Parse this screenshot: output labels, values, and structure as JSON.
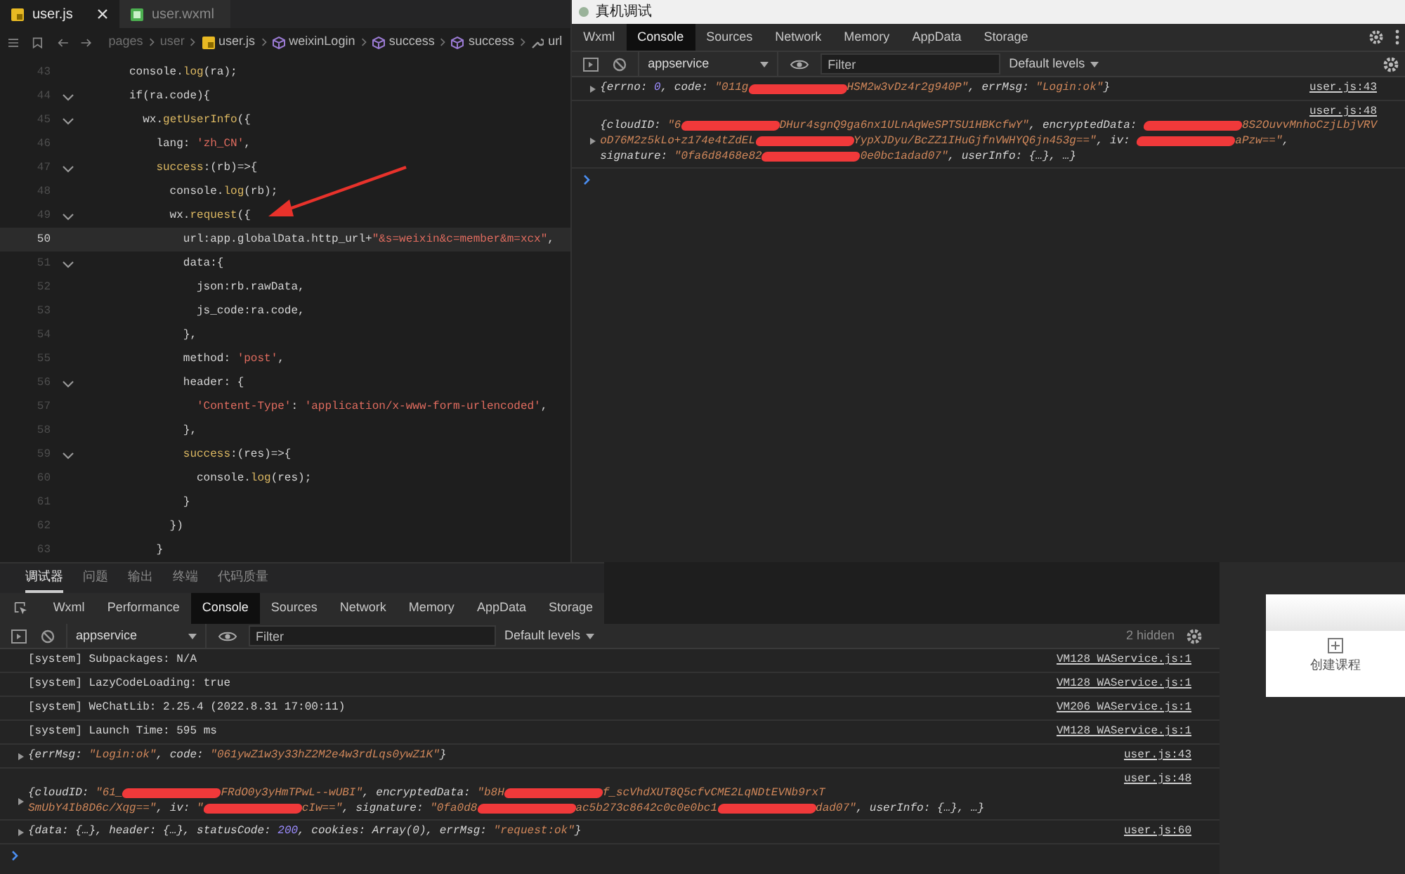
{
  "editor": {
    "tabs": [
      {
        "label": "user.js",
        "kind": "js",
        "selected": true
      },
      {
        "label": "user.wxml",
        "kind": "wxml",
        "selected": false
      }
    ],
    "breadcrumb": [
      {
        "kind": "folder",
        "label": "pages"
      },
      {
        "kind": "folder",
        "label": "user"
      },
      {
        "kind": "file",
        "label": "user.js"
      },
      {
        "kind": "method",
        "label": "weixinLogin"
      },
      {
        "kind": "method",
        "label": "success"
      },
      {
        "kind": "method",
        "label": "success"
      },
      {
        "kind": "property",
        "label": "url"
      }
    ],
    "lines": [
      {
        "number": "43",
        "foldable": false,
        "current": false,
        "tokens": [
          {
            "kind": "plain",
            "text": "console."
          },
          {
            "kind": "fn",
            "text": "log"
          },
          {
            "kind": "plain",
            "text": "(ra);"
          }
        ]
      },
      {
        "number": "44",
        "foldable": true,
        "current": false,
        "tokens": [
          {
            "kind": "plain",
            "text": "if(ra.code){"
          }
        ]
      },
      {
        "number": "45",
        "foldable": true,
        "current": false,
        "tokens": [
          {
            "kind": "plain",
            "text": "  wx."
          },
          {
            "kind": "fn",
            "text": "getUserInfo"
          },
          {
            "kind": "plain",
            "text": "({"
          }
        ]
      },
      {
        "number": "46",
        "foldable": false,
        "current": false,
        "tokens": [
          {
            "kind": "plain",
            "text": "    lang: "
          },
          {
            "kind": "str",
            "text": "'zh_CN'"
          },
          {
            "kind": "plain",
            "text": ","
          }
        ]
      },
      {
        "number": "47",
        "foldable": true,
        "current": false,
        "tokens": [
          {
            "kind": "fn",
            "text": "    success"
          },
          {
            "kind": "plain",
            "text": ":(rb)=>{"
          }
        ]
      },
      {
        "number": "48",
        "foldable": false,
        "current": false,
        "tokens": [
          {
            "kind": "plain",
            "text": "      console."
          },
          {
            "kind": "fn",
            "text": "log"
          },
          {
            "kind": "plain",
            "text": "(rb);"
          }
        ]
      },
      {
        "number": "49",
        "foldable": true,
        "current": false,
        "tokens": [
          {
            "kind": "plain",
            "text": "      wx."
          },
          {
            "kind": "fn",
            "text": "request"
          },
          {
            "kind": "plain",
            "text": "({"
          }
        ]
      },
      {
        "number": "50",
        "foldable": false,
        "current": true,
        "tokens": [
          {
            "kind": "plain",
            "text": "        url:app.globalData.http_url+"
          },
          {
            "kind": "str",
            "text": "\"&s=weixin&c=member&m=xcx\""
          },
          {
            "kind": "plain",
            "text": ","
          }
        ]
      },
      {
        "number": "51",
        "foldable": true,
        "current": false,
        "tokens": [
          {
            "kind": "plain",
            "text": "        data:{"
          }
        ]
      },
      {
        "number": "52",
        "foldable": false,
        "current": false,
        "tokens": [
          {
            "kind": "plain",
            "text": "          json:rb.rawData,"
          }
        ]
      },
      {
        "number": "53",
        "foldable": false,
        "current": false,
        "tokens": [
          {
            "kind": "plain",
            "text": "          js_code:ra.code,"
          }
        ]
      },
      {
        "number": "54",
        "foldable": false,
        "current": false,
        "tokens": [
          {
            "kind": "plain",
            "text": "        },"
          }
        ]
      },
      {
        "number": "55",
        "foldable": false,
        "current": false,
        "tokens": [
          {
            "kind": "plain",
            "text": "        method: "
          },
          {
            "kind": "str",
            "text": "'post'"
          },
          {
            "kind": "plain",
            "text": ","
          }
        ]
      },
      {
        "number": "56",
        "foldable": true,
        "current": false,
        "tokens": [
          {
            "kind": "plain",
            "text": "        header: {"
          }
        ]
      },
      {
        "number": "57",
        "foldable": false,
        "current": false,
        "tokens": [
          {
            "kind": "str",
            "text": "          'Content-Type'"
          },
          {
            "kind": "plain",
            "text": ": "
          },
          {
            "kind": "str",
            "text": "'application/x-www-form-urlencoded'"
          },
          {
            "kind": "plain",
            "text": ","
          }
        ]
      },
      {
        "number": "58",
        "foldable": false,
        "current": false,
        "tokens": [
          {
            "kind": "plain",
            "text": "        },"
          }
        ]
      },
      {
        "number": "59",
        "foldable": true,
        "current": false,
        "tokens": [
          {
            "kind": "fn",
            "text": "        success"
          },
          {
            "kind": "plain",
            "text": ":(res)=>{"
          }
        ]
      },
      {
        "number": "60",
        "foldable": false,
        "current": false,
        "tokens": [
          {
            "kind": "plain",
            "text": "          console."
          },
          {
            "kind": "fn",
            "text": "log"
          },
          {
            "kind": "plain",
            "text": "(res);"
          }
        ]
      },
      {
        "number": "61",
        "foldable": false,
        "current": false,
        "tokens": [
          {
            "kind": "plain",
            "text": "        }"
          }
        ]
      },
      {
        "number": "62",
        "foldable": false,
        "current": false,
        "tokens": [
          {
            "kind": "plain",
            "text": "      })"
          }
        ]
      },
      {
        "number": "63",
        "foldable": false,
        "current": false,
        "tokens": [
          {
            "kind": "plain",
            "text": "    }"
          }
        ]
      }
    ]
  },
  "device_debugger": {
    "title": "真机调试",
    "tabs": [
      {
        "label": "Wxml",
        "selected": false
      },
      {
        "label": "Console",
        "selected": true
      },
      {
        "label": "Sources",
        "selected": false
      },
      {
        "label": "Network",
        "selected": false
      },
      {
        "label": "Memory",
        "selected": false
      },
      {
        "label": "AppData",
        "selected": false
      },
      {
        "label": "Storage",
        "selected": false
      }
    ],
    "context": "appservice",
    "filter_placeholder": "Filter",
    "levels": "Default levels",
    "entries": [
      {
        "source": "user.js:43",
        "expandable": true,
        "lines": [
          [
            {
              "kind": "text",
              "text": "{errno: "
            },
            {
              "kind": "num",
              "text": "0"
            },
            {
              "kind": "text",
              "text": ", code: "
            },
            {
              "kind": "str",
              "text": "\"011g"
            },
            {
              "kind": "redaction"
            },
            {
              "kind": "str",
              "text": "HSM2w3vDz4r2g940P\""
            },
            {
              "kind": "text",
              "text": ", errMsg: "
            },
            {
              "kind": "str",
              "text": "\"Login:ok\""
            },
            {
              "kind": "text",
              "text": "}"
            }
          ]
        ]
      },
      {
        "source": "user.js:48",
        "expandable": true,
        "lines": [
          [
            {
              "kind": "text",
              "text": "{cloudID: "
            },
            {
              "kind": "str",
              "text": "\"6"
            },
            {
              "kind": "redaction"
            },
            {
              "kind": "str",
              "text": "DHur4sgnQ9ga6nx1ULnAqWeSPTSU1HBKcfwY\""
            },
            {
              "kind": "text",
              "text": ", encryptedData: "
            },
            {
              "kind": "redaction"
            },
            {
              "kind": "str",
              "text": "8S2OuvvMnhoCzjLbjVRV"
            }
          ],
          [
            {
              "kind": "str",
              "text": "oD76M2z5kLo+z174e4tZdEL"
            },
            {
              "kind": "redaction"
            },
            {
              "kind": "str",
              "text": "YypXJDyu/BcZZ1IHuGjfnVWHYQ6jn453g==\""
            },
            {
              "kind": "text",
              "text": ", iv: "
            },
            {
              "kind": "redaction"
            },
            {
              "kind": "str",
              "text": "aPzw==\""
            },
            {
              "kind": "text",
              "text": ","
            }
          ],
          [
            {
              "kind": "text",
              "text": "signature: "
            },
            {
              "kind": "str",
              "text": "\"0fa6d8468e82"
            },
            {
              "kind": "redaction"
            },
            {
              "kind": "str",
              "text": "0e0bc1adad07\""
            },
            {
              "kind": "text",
              "text": ", userInfo: {…}, …}"
            }
          ]
        ]
      }
    ]
  },
  "bottom_panel": {
    "tabs": [
      {
        "label": "调试器",
        "selected": true
      },
      {
        "label": "问题",
        "selected": false
      },
      {
        "label": "输出",
        "selected": false
      },
      {
        "label": "终端",
        "selected": false
      },
      {
        "label": "代码质量",
        "selected": false
      }
    ],
    "devtools_tabs": [
      {
        "label": "Wxml",
        "selected": false
      },
      {
        "label": "Performance",
        "selected": false
      },
      {
        "label": "Console",
        "selected": true
      },
      {
        "label": "Sources",
        "selected": false
      },
      {
        "label": "Network",
        "selected": false
      },
      {
        "label": "Memory",
        "selected": false
      },
      {
        "label": "AppData",
        "selected": false
      },
      {
        "label": "Storage",
        "selected": false
      }
    ],
    "context": "appservice",
    "filter_placeholder": "Filter",
    "levels": "Default levels",
    "hidden": "2 hidden",
    "entries": [
      {
        "source": "VM128 WAService.js:1",
        "expandable": false,
        "lines": [
          [
            {
              "kind": "text",
              "text": "[system] Subpackages: N/A"
            }
          ]
        ]
      },
      {
        "source": "VM128 WAService.js:1",
        "expandable": false,
        "lines": [
          [
            {
              "kind": "text",
              "text": "[system] LazyCodeLoading: true"
            }
          ]
        ]
      },
      {
        "source": "VM206 WAService.js:1",
        "expandable": false,
        "lines": [
          [
            {
              "kind": "text",
              "text": "[system] WeChatLib: 2.25.4 (2022.8.31 17:00:11)"
            }
          ]
        ]
      },
      {
        "source": "VM128 WAService.js:1",
        "expandable": false,
        "lines": [
          [
            {
              "kind": "text",
              "text": "[system] Launch Time: 595 ms"
            }
          ]
        ]
      },
      {
        "source": "user.js:43",
        "expandable": true,
        "lines": [
          [
            {
              "kind": "text",
              "text": "{errMsg: "
            },
            {
              "kind": "str",
              "text": "\"Login:ok\""
            },
            {
              "kind": "text",
              "text": ", code: "
            },
            {
              "kind": "str",
              "text": "\"061ywZ1w3y33hZ2M2e4w3rdLqs0ywZ1K\""
            },
            {
              "kind": "text",
              "text": "}"
            }
          ]
        ]
      },
      {
        "source": "user.js:48",
        "expandable": true,
        "lines": [
          [
            {
              "kind": "text",
              "text": "{cloudID: "
            },
            {
              "kind": "str",
              "text": "\"61_"
            },
            {
              "kind": "redaction"
            },
            {
              "kind": "str",
              "text": "FRdO0y3yHmTPwL--wUBI\""
            },
            {
              "kind": "text",
              "text": ", encryptedData: "
            },
            {
              "kind": "str",
              "text": "\"b8H"
            },
            {
              "kind": "redaction"
            },
            {
              "kind": "str",
              "text": "f_scVhdXUT8Q5cfvCME2LqNDtEVNb9rxT"
            }
          ],
          [
            {
              "kind": "str",
              "text": "SmUbY4Ib8D6c/Xqg==\""
            },
            {
              "kind": "text",
              "text": ", iv: "
            },
            {
              "kind": "str",
              "text": "\""
            },
            {
              "kind": "redaction"
            },
            {
              "kind": "str",
              "text": "cIw==\""
            },
            {
              "kind": "text",
              "text": ", signature: "
            },
            {
              "kind": "str",
              "text": "\"0fa0d8"
            },
            {
              "kind": "redaction"
            },
            {
              "kind": "str",
              "text": "ac5b273c8642c0c0e0bc1"
            },
            {
              "kind": "redaction"
            },
            {
              "kind": "str",
              "text": "dad07\""
            },
            {
              "kind": "text",
              "text": ", userInfo: {…}, …}"
            }
          ]
        ]
      },
      {
        "source": "user.js:60",
        "expandable": true,
        "lines": [
          [
            {
              "kind": "text",
              "text": "{data: {…}, header: {…}, statusCode: "
            },
            {
              "kind": "num",
              "text": "200"
            },
            {
              "kind": "text",
              "text": ", cookies: Array(0), errMsg: "
            },
            {
              "kind": "str",
              "text": "\"request:ok\""
            },
            {
              "kind": "text",
              "text": "}"
            }
          ]
        ]
      }
    ]
  },
  "preview_card": {
    "label": "创建课程"
  }
}
